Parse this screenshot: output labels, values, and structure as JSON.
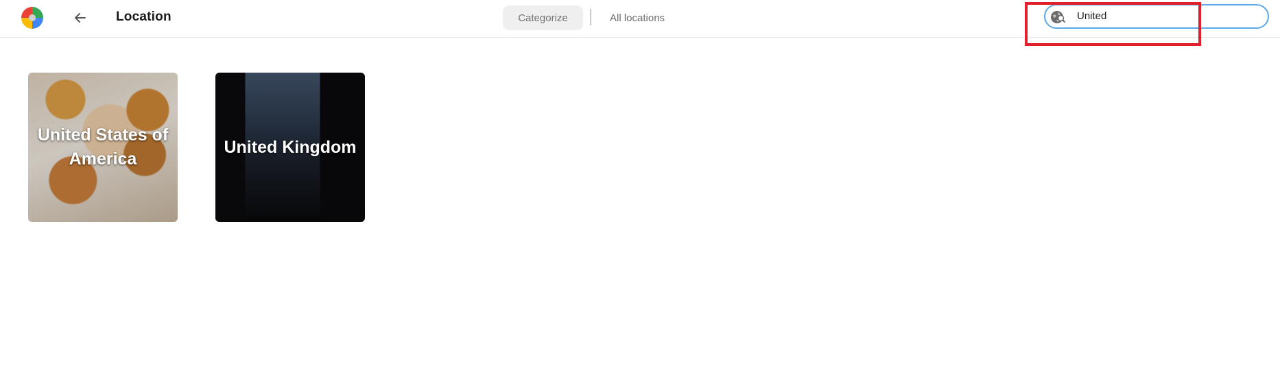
{
  "header": {
    "title": "Location",
    "tabs": [
      {
        "label": "Categorize",
        "active": true
      },
      {
        "label": "All locations",
        "active": false
      }
    ]
  },
  "search": {
    "value": "United",
    "icon": "globe-search-icon",
    "border_color": "#5aa9e6"
  },
  "highlight_color": "#e0202a",
  "locations": [
    {
      "name": "United States of America"
    },
    {
      "name": "United Kingdom"
    }
  ]
}
